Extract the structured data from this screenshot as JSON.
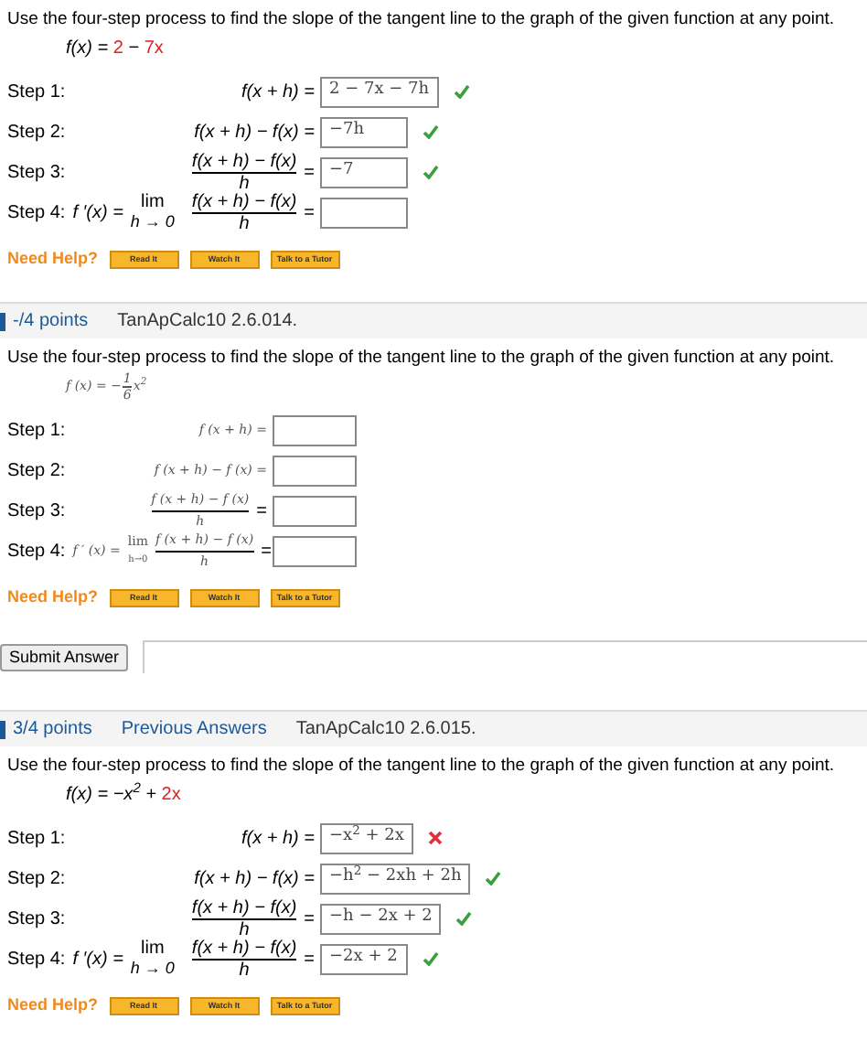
{
  "problems": [
    {
      "prompt": "Use the four-step process to find the slope of the tangent line to the graph of the given function at any point.",
      "function": [
        {
          "kind": "text",
          "text": "f(x) = ",
          "highlight": false
        },
        {
          "kind": "text",
          "text": "2",
          "highlight": true
        },
        {
          "kind": "text",
          "text": " − ",
          "highlight": false
        },
        {
          "kind": "text",
          "text": "7x",
          "highlight": true
        }
      ],
      "steps": [
        {
          "label": "Step 1:",
          "expression": {
            "kind": "plain",
            "text": "f(x + h) ="
          },
          "answer": "2 − 7x − 7h",
          "correct": true
        },
        {
          "label": "Step 2:",
          "expression": {
            "kind": "plain",
            "text": "f(x + h) − f(x) ="
          },
          "answer": "−7h",
          "correct": true
        },
        {
          "label": "Step 3:",
          "expression": {
            "kind": "fraction",
            "numerator": "f(x + h) − f(x)",
            "denominator": "h",
            "equals": "="
          },
          "answer": "−7",
          "correct": true
        },
        {
          "label": "Step 4:",
          "prefix": "f ′(x) =",
          "limit": {
            "top": "lim",
            "bottom": "h → 0"
          },
          "expression": {
            "kind": "fraction",
            "numerator": "f(x + h) − f(x)",
            "denominator": "h",
            "equals": "="
          }
        }
      ],
      "help": {
        "label": "Need Help?",
        "buttons": [
          "Read It",
          "Watch It",
          "Talk to a Tutor"
        ]
      }
    },
    {
      "header": {
        "points": "-/4 points",
        "code": "TanApCalc10 2.6.014."
      },
      "prompt": "Use the four-step process to find the slope of the tangent line to the graph of the given function at any point.",
      "function": [
        {
          "kind": "text",
          "text": "f (x) = −",
          "highlight": false
        },
        {
          "kind": "fraction",
          "numerator": "1",
          "denominator": "6"
        },
        {
          "kind": "text",
          "text": "x$^{2}$",
          "highlight": false
        }
      ],
      "steps": [
        {
          "label": "Step 1:",
          "expression": {
            "kind": "plain",
            "text": "f (x + h) ="
          }
        },
        {
          "label": "Step 2:",
          "expression": {
            "kind": "plain",
            "text": "f (x + h) − f (x) ="
          }
        },
        {
          "label": "Step 3:",
          "expression": {
            "kind": "fraction",
            "numerator": "f (x + h) − f (x)",
            "denominator": "h",
            "equals": "="
          }
        },
        {
          "label": "Step 4:",
          "prefix": "f ′ (x) =",
          "limit": {
            "top": "lim",
            "bottom": "h→0"
          },
          "expression": {
            "kind": "fraction",
            "numerator": "f (x + h) − f (x)",
            "denominator": "h",
            "equals": "="
          }
        }
      ],
      "help": {
        "label": "Need Help?",
        "buttons": [
          "Read It",
          "Watch It",
          "Talk to a Tutor"
        ]
      },
      "submit": "Submit Answer"
    },
    {
      "header": {
        "points": "3/4 points",
        "link": "Previous Answers",
        "code": "TanApCalc10 2.6.015."
      },
      "prompt": "Use the four-step process to find the slope of the tangent line to the graph of the given function at any point.",
      "function": [
        {
          "kind": "text",
          "text": "f(x) = −x$^{2}$ + ",
          "highlight": false
        },
        {
          "kind": "text",
          "text": "2x",
          "highlight": true
        }
      ],
      "steps": [
        {
          "label": "Step 1:",
          "expression": {
            "kind": "plain",
            "text": "f(x + h) ="
          },
          "answer": "−x$^{2}$ + 2x",
          "correct": false
        },
        {
          "label": "Step 2:",
          "expression": {
            "kind": "plain",
            "text": "f(x + h) − f(x) ="
          },
          "answer": "−h$^{2}$ − 2xh + 2h",
          "correct": true
        },
        {
          "label": "Step 3:",
          "expression": {
            "kind": "fraction",
            "numerator": "f(x + h) − f(x)",
            "denominator": "h",
            "equals": "="
          },
          "answer": "−h − 2x + 2",
          "correct": true
        },
        {
          "label": "Step 4:",
          "prefix": "f ′(x) =",
          "limit": {
            "top": "lim",
            "bottom": "h → 0"
          },
          "expression": {
            "kind": "fraction",
            "numerator": "f(x + h) − f(x)",
            "denominator": "h",
            "equals": "="
          },
          "answer": "−2x + 2",
          "correct": true
        }
      ],
      "help": {
        "label": "Need Help?",
        "buttons": [
          "Read It",
          "Watch It",
          "Talk to a Tutor"
        ]
      }
    }
  ]
}
